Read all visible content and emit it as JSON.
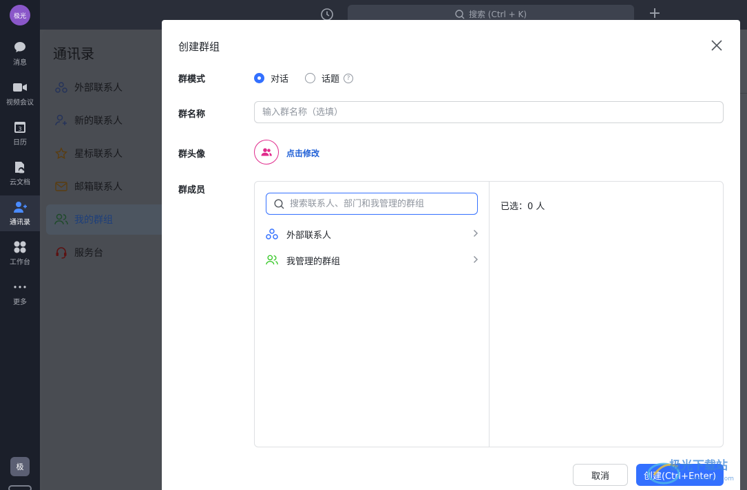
{
  "rail": {
    "user_avatar": "极光",
    "items": [
      {
        "label": "消息",
        "icon": "chat-bubble-icon"
      },
      {
        "label": "视频会议",
        "icon": "video-camera-icon"
      },
      {
        "label": "日历",
        "icon": "calendar-icon"
      },
      {
        "label": "云文档",
        "icon": "cloud-doc-icon"
      },
      {
        "label": "通讯录",
        "icon": "contacts-icon",
        "active": true
      },
      {
        "label": "工作台",
        "icon": "grid-apps-icon"
      },
      {
        "label": "更多",
        "icon": "more-dots-icon"
      }
    ],
    "bottom_avatar": "极"
  },
  "topbar": {
    "search_placeholder": "搜索 (Ctrl + K)"
  },
  "contacts": {
    "title": "通讯录",
    "items": [
      {
        "label": "外部联系人",
        "icon": "external-contacts-icon"
      },
      {
        "label": "新的联系人",
        "icon": "add-contact-icon"
      },
      {
        "label": "星标联系人",
        "icon": "star-icon"
      },
      {
        "label": "邮箱联系人",
        "icon": "mail-icon"
      },
      {
        "label": "我的群组",
        "icon": "group-icon",
        "active": true
      },
      {
        "label": "服务台",
        "icon": "headset-icon"
      }
    ]
  },
  "dialog": {
    "title": "创建群组",
    "mode_label": "群模式",
    "mode_options": [
      {
        "label": "对话",
        "checked": true
      },
      {
        "label": "话题",
        "checked": false
      }
    ],
    "name_label": "群名称",
    "name_placeholder": "输入群名称（选填）",
    "avatar_label": "群头像",
    "avatar_action": "点击修改",
    "members_label": "群成员",
    "member_search_placeholder": "搜索联系人、部门和我管理的群组",
    "member_sources": [
      {
        "label": "外部联系人",
        "icon": "external-contacts-icon"
      },
      {
        "label": "我管理的群组",
        "icon": "group-icon"
      }
    ],
    "selected_text": "已选：0 人",
    "cancel_label": "取消",
    "create_label": "创建(Ctrl+Enter)"
  },
  "watermark_text": "极光下载站",
  "colors": {
    "accent": "#3370ff",
    "avatar_pink": "#e02b8c",
    "rail_bg": "#1b1f2a"
  }
}
